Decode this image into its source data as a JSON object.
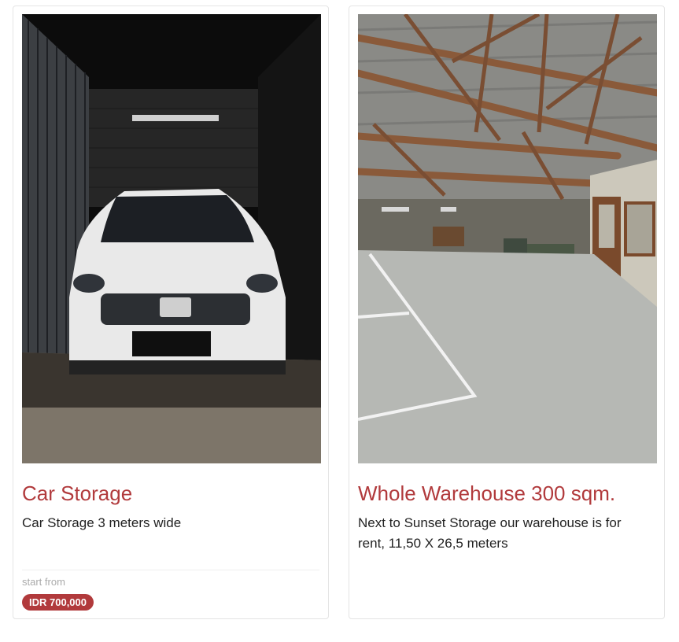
{
  "listings": [
    {
      "title": "Car Storage",
      "description": "Car Storage 3 meters wide",
      "price_prefix": "start from",
      "price": "IDR 700,000",
      "photo_alt": "White Honda SUV parked in a storage unit"
    },
    {
      "title": "Whole Warehouse 300 sqm.",
      "description": "Next to Sunset Storage our warehouse is for rent, 11,50 X 26,5 meters",
      "photo_alt": "Empty warehouse interior with wooden roof trusses"
    }
  ],
  "colors": {
    "accent": "#b13a3c",
    "text": "#222222",
    "muted": "#aaaaaa",
    "border": "#e4e4e4"
  }
}
